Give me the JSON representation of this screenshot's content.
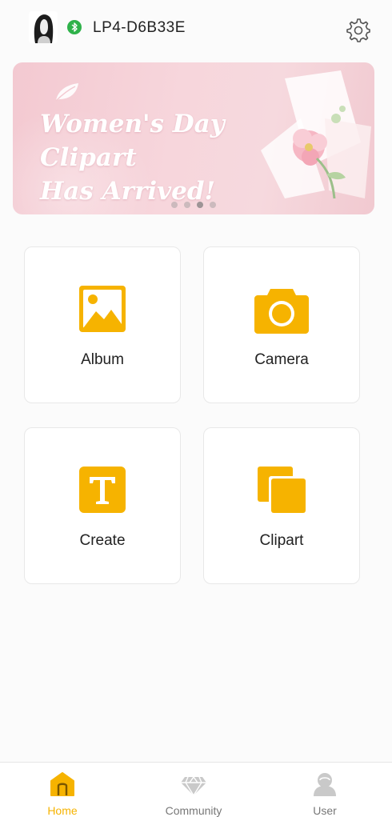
{
  "header": {
    "device_name": "LP4-D6B33E",
    "avatar_icon": "avatar-icon",
    "bluetooth_icon": "bluetooth-icon",
    "settings_icon": "gear-icon"
  },
  "banner": {
    "title": "Women's Day Clipart\nHas Arrived!",
    "slide_count": 4,
    "active_slide": 3
  },
  "tiles": [
    {
      "label": "Album",
      "icon": "image-icon"
    },
    {
      "label": "Camera",
      "icon": "camera-icon"
    },
    {
      "label": "Create",
      "icon": "text-icon"
    },
    {
      "label": "Clipart",
      "icon": "clipart-icon"
    }
  ],
  "nav": {
    "items": [
      {
        "label": "Home",
        "icon": "home-icon",
        "active": true
      },
      {
        "label": "Community",
        "icon": "diamond-icon",
        "active": false
      },
      {
        "label": "User",
        "icon": "user-icon",
        "active": false
      }
    ]
  },
  "colors": {
    "accent": "#f6b300",
    "bluetooth": "#2fb24a",
    "banner_bg": "#f5d2d9",
    "inactive_nav": "#777777"
  }
}
